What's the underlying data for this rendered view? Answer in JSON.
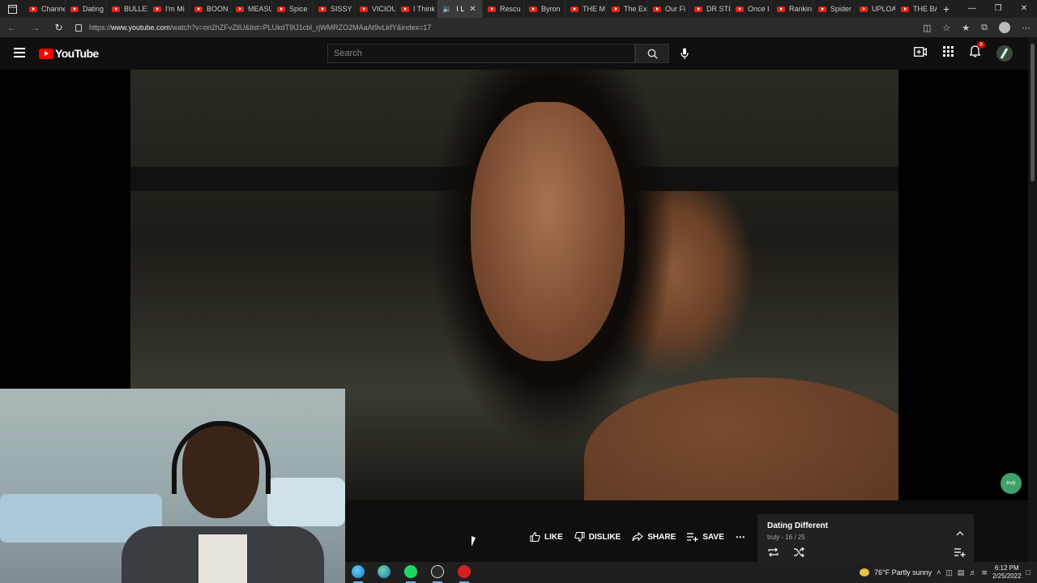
{
  "browser": {
    "tabs": [
      {
        "label": "Channel"
      },
      {
        "label": "Dating"
      },
      {
        "label": "BULLE"
      },
      {
        "label": "I'm Mi"
      },
      {
        "label": "BOON"
      },
      {
        "label": "MEASU"
      },
      {
        "label": "Spice"
      },
      {
        "label": "SISSY"
      },
      {
        "label": "VICIOU"
      },
      {
        "label": "I Think"
      },
      {
        "label": "I L"
      },
      {
        "label": "Rescu"
      },
      {
        "label": "Byron"
      },
      {
        "label": "THE M"
      },
      {
        "label": "The Ex"
      },
      {
        "label": "Our Fi"
      },
      {
        "label": "DR STI"
      },
      {
        "label": "Once I"
      },
      {
        "label": "Rankin"
      },
      {
        "label": "Spider"
      },
      {
        "label": "UPLOA"
      },
      {
        "label": "THE BA"
      }
    ],
    "active_tab_index": 10,
    "url_prefix": "https://",
    "url_host": "www.youtube.com",
    "url_path": "/watch?v=on2hZFvZllU&list=PLUkdT9lJ1cbl_rjWMRZO2MAaAt9vLkfY&index=17"
  },
  "youtube": {
    "logo_text": "YouTube",
    "search_placeholder": "Search",
    "notification_count": "8"
  },
  "actions": {
    "like": "LIKE",
    "dislike": "DISLIKE",
    "share": "SHARE",
    "save": "SAVE"
  },
  "playlist": {
    "title": "Dating Different",
    "subtitle": "truly - 16 / 25"
  },
  "watermark": "truly",
  "taskbar": {
    "weather": "76°F  Partly sunny",
    "time": "6:12 PM",
    "date": "2/25/2022"
  },
  "colors": {
    "youtube_red": "#ff0000",
    "background": "#0f0f0f",
    "playlist_bg": "#212121"
  }
}
